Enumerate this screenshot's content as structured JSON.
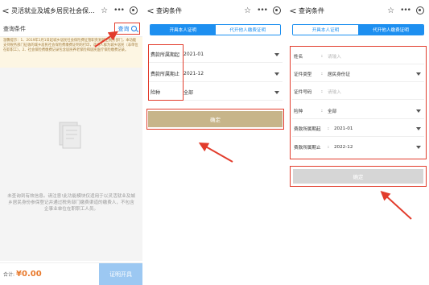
{
  "colors": {
    "accent": "#1d8ff0",
    "highlight": "#e23c2c",
    "amount": "#e8792b",
    "notice_bg": "#fdf6e3"
  },
  "panel1": {
    "title": "灵活就业及城乡居民社会保...",
    "query_section": "查询条件",
    "query_button": "查询",
    "notice": "温馨提示：1、2019年1月1日起城乡居民社会保险费征管职责划转至税务部门，本功能支持税务部门征收的城乡居民社会保险费缴费证明的打印，选用人群为城乡居民（非单位在职职工）。2、社会保险费缴费记录包含居民养老保险和居民医疗保险缴费记录。",
    "empty_text": "未查询到有效信息。请注意!此功能模块仅适用于以灵活就业及城乡居民身份参保登记并通过税务部门缴费渠道的缴费人，不包含企事业单位在职职工人员。",
    "total_label": "合计:",
    "total_value": "¥0.00",
    "proof_button": "证明开具"
  },
  "panel2": {
    "title": "查询条件",
    "tabs": [
      "开具本人证明",
      "代开他人缴费证明"
    ],
    "fields": [
      {
        "label": "费款所属期起",
        "value": "2021-01"
      },
      {
        "label": "费款所属期止",
        "value": "2021-12"
      },
      {
        "label": "险种",
        "value": "全部"
      }
    ],
    "confirm": "确定"
  },
  "panel3": {
    "title": "查询条件",
    "tabs": [
      "开具本人证明",
      "代开他人缴费证明"
    ],
    "fields": [
      {
        "label": "姓名",
        "value": "",
        "placeholder": "请输入"
      },
      {
        "label": "证件类型",
        "value": "居民身份证",
        "placeholder": ""
      },
      {
        "label": "证件号码",
        "value": "",
        "placeholder": "请输入"
      },
      {
        "label": "险种",
        "value": "全部",
        "placeholder": ""
      },
      {
        "label": "费款所属期起",
        "value": "2021-01",
        "placeholder": ""
      },
      {
        "label": "费款所属期止",
        "value": "2022-12",
        "placeholder": ""
      }
    ],
    "confirm": "确定"
  },
  "icons": [
    "back-icon",
    "star-icon",
    "more-icon",
    "target-icon",
    "search-icon",
    "document-icon",
    "chevron-down-icon"
  ]
}
